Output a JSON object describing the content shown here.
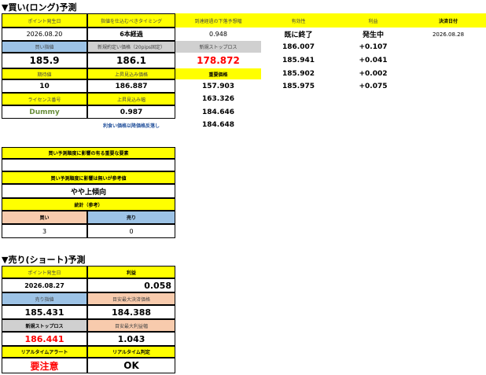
{
  "buy_section": {
    "title": "▼買い(ロング)予測",
    "headers": {
      "point_date": "ポイント発生日",
      "timing": "指値を仕込むべきタイミング",
      "target_date": "到達経過の下落予想幅",
      "validity": "有効性",
      "profit": "利益",
      "settle_date": "決済日付"
    },
    "row1": {
      "point_date": "2026.08.20",
      "timing": "6本経過",
      "decline": "0.948",
      "validity": "既に終了",
      "status": "発生中",
      "settle_date": "2026.08.28"
    },
    "subheaders": {
      "buy_limit": "買い指値",
      "new_buy_price": "新規約定い価格（20pips固定）",
      "new_stoploss": "新規ストップロス",
      "important_price": "重要価格",
      "hold_value": "期待値",
      "upper_limit": "上昇見込み価格",
      "license": "ライセンス番号",
      "upper_width": "上昇見込み幅",
      "note": "利食い価格以降価格反落し"
    },
    "row2": {
      "buy_limit": "185.9",
      "new_buy_price": "186.1",
      "new_stoploss": "178.872",
      "price_a": "186.007",
      "profit_a": "+0.107"
    },
    "row_b": {
      "price": "185.941",
      "profit": "+0.041"
    },
    "row3": {
      "hold_value": "10",
      "upper_limit": "186.887",
      "important_price_1": "157.903",
      "price_c": "185.902",
      "profit_c": "+0.002"
    },
    "row_d": {
      "price": "185.975",
      "profit": "+0.075"
    },
    "row4": {
      "important_price_2": "163.326"
    },
    "row5": {
      "license": "Dummy",
      "upper_width": "0.987",
      "important_price_3": "184.646"
    },
    "row6": {
      "important_price_4": "184.648"
    }
  },
  "factor_section": {
    "label1": "買い予測順度に影響の有る重要な要素",
    "value1": "",
    "label2": "買い予測順度に影響は無いが参考値",
    "trend": "やや上傾向",
    "stats_label": "統計（参考）",
    "buy_label": "買い",
    "sell_label": "売り",
    "buy_count": "3",
    "sell_count": "0"
  },
  "sell_section": {
    "title": "▼売り(ショート)予測",
    "point_date_label": "ポイント発生日",
    "profit_label": "利益",
    "point_date": "2026.08.27",
    "profit": "0.058",
    "sell_limit_label": "売り指値",
    "max_settle_label": "目安最大決済価格",
    "sell_limit": "185.431",
    "max_settle": "184.388",
    "stoploss_label": "新規ストップロス",
    "max_profit_label": "目安最大利益幅",
    "stoploss": "186.441",
    "max_profit": "1.043",
    "alert_label": "リアルタイムアラート",
    "judge_label": "リアルタイム判定",
    "alert": "要注意",
    "judge": "OK"
  }
}
